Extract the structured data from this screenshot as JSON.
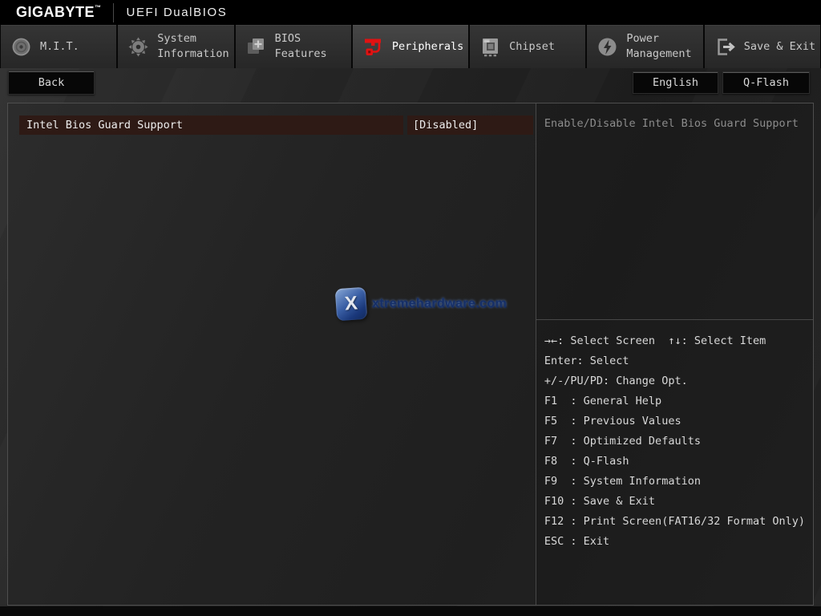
{
  "header": {
    "brand": "GIGABYTE",
    "trademark": "™",
    "title": "UEFI DualBIOS"
  },
  "tabs": [
    {
      "label": "M.I.T.",
      "icon": "mit-dial-icon",
      "active": false
    },
    {
      "label": "System Information",
      "icon": "gear-icon",
      "active": false
    },
    {
      "label": "BIOS Features",
      "icon": "chip-plus-icon",
      "active": false
    },
    {
      "label": "Peripherals",
      "icon": "peripherals-plug-icon",
      "active": true
    },
    {
      "label": "Chipset",
      "icon": "chipset-icon",
      "active": false
    },
    {
      "label": "Power Management",
      "icon": "power-bolt-icon",
      "active": false
    },
    {
      "label": "Save & Exit",
      "icon": "exit-door-icon",
      "active": false
    }
  ],
  "toolbar": {
    "back": "Back",
    "language": "English",
    "qflash": "Q-Flash"
  },
  "settings": [
    {
      "label": "Intel Bios Guard Support",
      "value": "[Disabled]",
      "selected": true
    }
  ],
  "help": {
    "description": "Enable/Disable Intel Bios Guard Support",
    "keys": [
      "→←: Select Screen  ↑↓: Select Item",
      "Enter: Select",
      "+/-/PU/PD: Change Opt.",
      "F1  : General Help",
      "F5  : Previous Values",
      "F7  : Optimized Defaults",
      "F8  : Q-Flash",
      "F9  : System Information",
      "F10 : Save & Exit",
      "F12 : Print Screen(FAT16/32 Format Only)",
      "ESC : Exit"
    ]
  },
  "watermark": {
    "letter": "X",
    "text": "xtremehardware.com"
  },
  "colors": {
    "accent_red": "#e11212",
    "selected_row_bg": "#2e1a15",
    "tab_bg": "#2e2e2e",
    "tab_active_bg": "#3f3f3f",
    "help_text": "#8c8c8c",
    "key_text": "#d8d8d8"
  }
}
